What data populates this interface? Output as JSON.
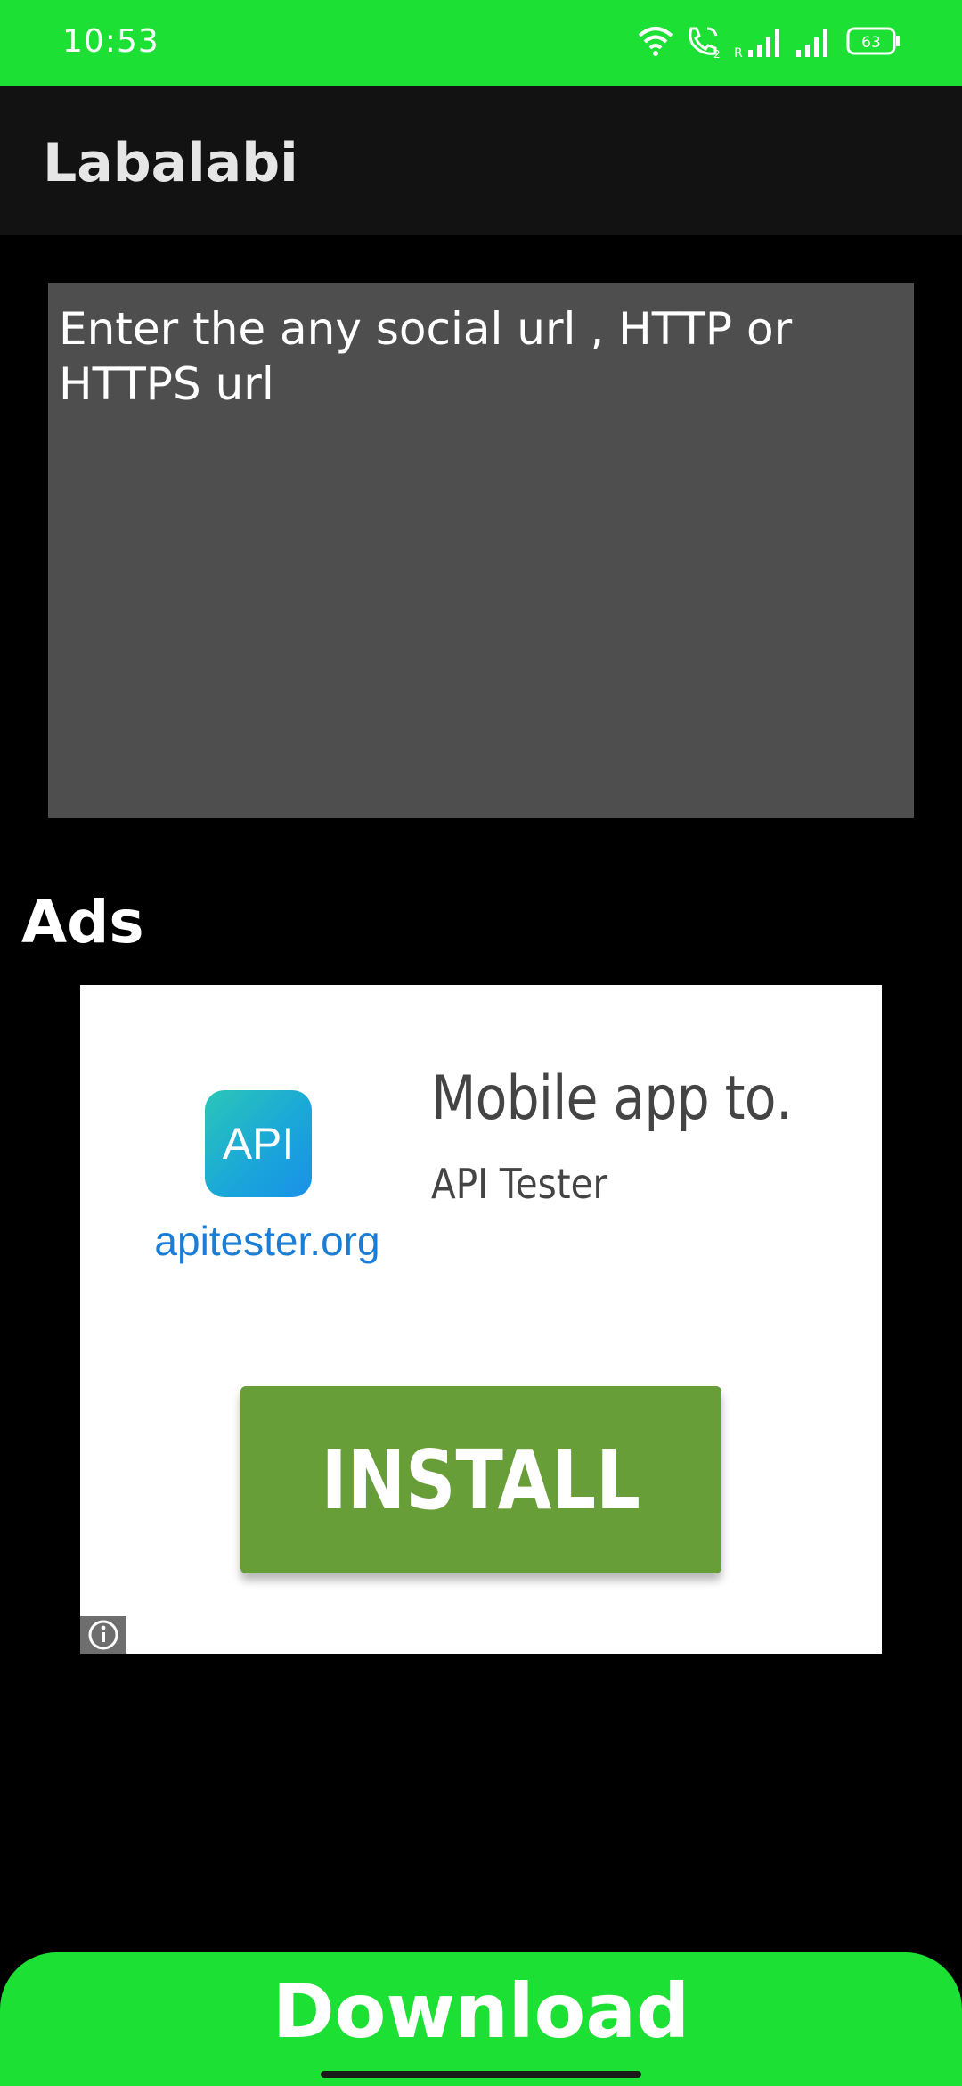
{
  "status_bar": {
    "time": "10:53",
    "battery": "63",
    "icons": [
      "wifi-icon",
      "wifi-calling-icon",
      "signal-roaming-icon",
      "signal-icon",
      "battery-icon"
    ]
  },
  "app_bar": {
    "title": "Labalabi"
  },
  "url_input": {
    "placeholder": "Enter the any social url , HTTP or HTTPS url",
    "value": ""
  },
  "ads": {
    "heading": "Ads",
    "card": {
      "logo_badge": "API",
      "logo_domain": "apitester.org",
      "headline": "Mobile app to…",
      "advertiser": "API Tester",
      "cta": "INSTALL",
      "info_icon": "info-icon"
    }
  },
  "download": {
    "label": "Download"
  },
  "colors": {
    "accent_green": "#1ce033",
    "install_green": "#679e37",
    "input_gray": "#4e4e4e",
    "app_bar": "#121212",
    "background": "#000000"
  }
}
